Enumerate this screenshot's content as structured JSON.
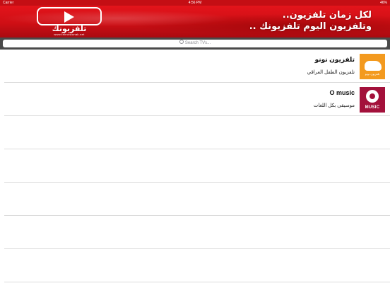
{
  "status_bar": {
    "carrier": "Carrier",
    "time": "4:56 PM",
    "battery": "46%"
  },
  "banner": {
    "logo_name": "تلفزيونك",
    "logo_url": "www.televisionak.net",
    "slogan_line1": "لكل زمان تلفزيون..",
    "slogan_line2": "وتلفزيون اليوم تلفزيونك .."
  },
  "search": {
    "placeholder": "Search TVs..."
  },
  "channels": [
    {
      "title": "تلفزيون نونو",
      "subtitle": "تلفزيون الطفل العراقي",
      "logo_text": "تلفزيون نونو",
      "color": "#f39a1f"
    },
    {
      "title": "O music",
      "subtitle": "موسيقى بكل اللغات",
      "logo_text": "MUSIC",
      "color": "#a3113b"
    }
  ],
  "colors": {
    "banner_red": "#d0131a",
    "search_bar_bg": "#4a4a4a",
    "separator": "#dcdcdc"
  }
}
